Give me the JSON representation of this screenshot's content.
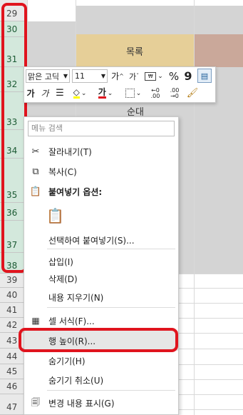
{
  "rows": {
    "top": [
      {
        "num": "29"
      },
      {
        "num": "30"
      },
      {
        "num": "31"
      },
      {
        "num": "32"
      },
      {
        "num": "33"
      },
      {
        "num": "34"
      },
      {
        "num": "35"
      },
      {
        "num": "36"
      },
      {
        "num": "37"
      },
      {
        "num": "38"
      }
    ],
    "bottom": [
      {
        "num": "39"
      },
      {
        "num": "40"
      },
      {
        "num": "41"
      },
      {
        "num": "42"
      },
      {
        "num": "43"
      },
      {
        "num": "44"
      },
      {
        "num": "45"
      },
      {
        "num": "46"
      },
      {
        "num": "47"
      }
    ]
  },
  "sheet": {
    "header_cell": "목록",
    "order_cell": "순대"
  },
  "mini_toolbar": {
    "font_name": "맑은 고딕",
    "font_size": "11",
    "grow_font": "가",
    "shrink_font": "가",
    "percent": "%",
    "comma": "9",
    "bold": "가",
    "italic": "가",
    "font_color": "가",
    "increase_decimal": ".00",
    "decrease_decimal": ".00"
  },
  "context_menu": {
    "search_placeholder": "메뉴 검색",
    "cut": "잘라내기(T)",
    "copy": "복사(C)",
    "paste_options": "붙여넣기 옵션:",
    "paste_special": "선택하여 붙여넣기(S)...",
    "insert": "삽입(I)",
    "delete": "삭제(D)",
    "clear_contents": "내용 지우기(N)",
    "format_cells": "셀 서식(F)...",
    "row_height": "행 높이(R)...",
    "hide": "숨기기(H)",
    "unhide": "숨기기 취소(U)",
    "show_changes": "변경 내용 표시(G)"
  },
  "colors": {
    "accent_red": "#e0141e",
    "header_fill": "#e6cf98",
    "header_fill_right": "#caa89a",
    "selection_green": "#d3e8dc"
  }
}
